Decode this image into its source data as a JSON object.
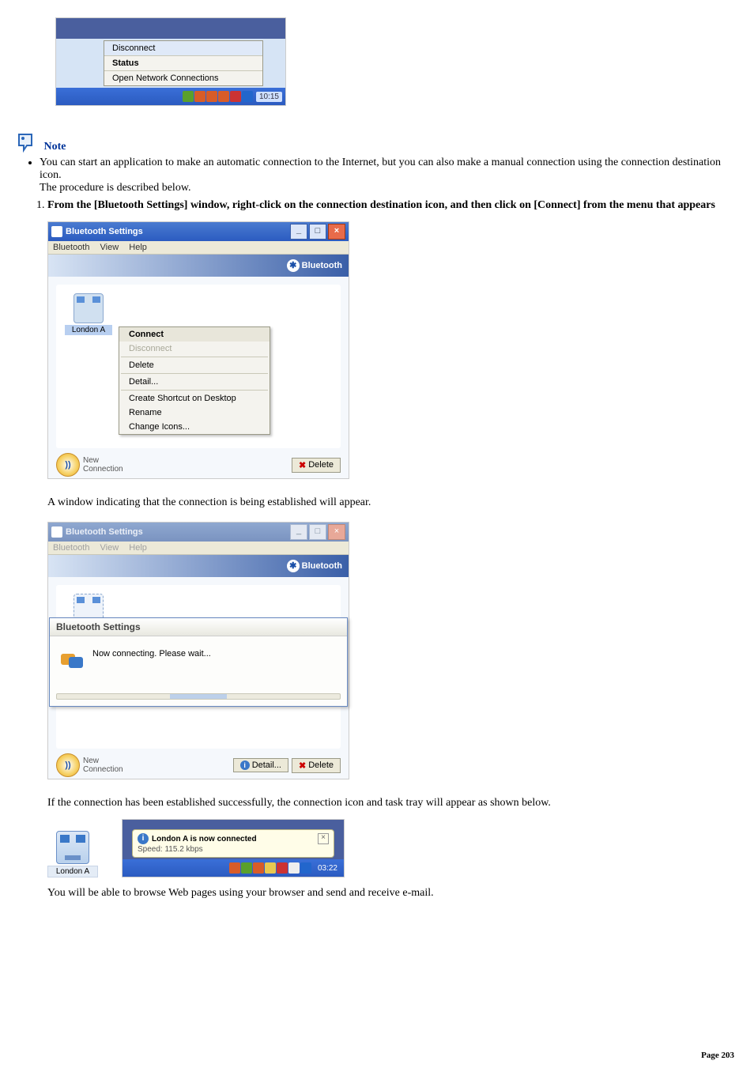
{
  "top_context_menu": {
    "items": [
      "Disconnect",
      "Status",
      "Open Network Connections"
    ],
    "clock": "10:15"
  },
  "note": {
    "label": "Note",
    "text1": "You can start an application to make an automatic connection to the Internet, but you can also make a manual connection using the connection destination icon.",
    "text2": "The procedure is described below."
  },
  "step1": {
    "title": "From the [Bluetooth Settings] window, right-click on the connection destination icon, and then click on [Connect] from the menu that appears",
    "window_title": "Bluetooth Settings",
    "menu": [
      "Bluetooth",
      "View",
      "Help"
    ],
    "brand": "Bluetooth",
    "device": "London A",
    "context_menu": [
      "Connect",
      "Disconnect",
      "Delete",
      "Detail...",
      "Create Shortcut on Desktop",
      "Rename",
      "Change Icons..."
    ],
    "new_connection": "New\nConnection",
    "delete_btn": "Delete"
  },
  "after1": "A window indicating that the connection is being established will appear.",
  "step2": {
    "window_title": "Bluetooth Settings",
    "menu": [
      "Bluetooth",
      "View",
      "Help"
    ],
    "brand": "Bluetooth",
    "dialog_title": "Bluetooth Settings",
    "dialog_msg": "Now connecting. Please wait...",
    "new_connection": "New\nConnection",
    "detail_btn": "Detail...",
    "delete_btn": "Delete"
  },
  "after2": "If the connection has been established successfully, the connection icon and task tray will appear as shown below.",
  "step3": {
    "device": "London A",
    "balloon_title": "London A is now connected",
    "balloon_speed": "Speed: 115.2 kbps",
    "clock": "03:22"
  },
  "after3": "You will be able to browse Web pages using your browser and send and receive e-mail.",
  "page": "Page 203"
}
